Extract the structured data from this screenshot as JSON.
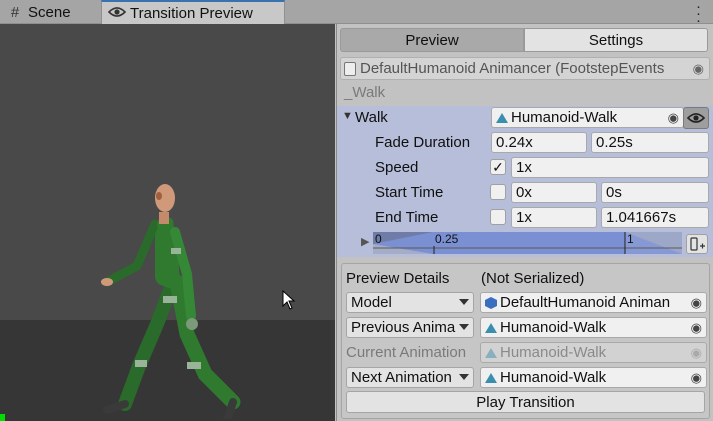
{
  "tabs": {
    "scene": "Scene",
    "transition_preview": "Transition Preview"
  },
  "icons": {
    "scene": "hash-icon",
    "transition_preview": "eye-icon",
    "menu": "kebab-menu-icon"
  },
  "inspector": {
    "mode_tabs": [
      "Preview",
      "Settings"
    ],
    "animancer_component": "DefaultHumanoid Animancer (FootstepEvents",
    "section_label": "_Walk",
    "walk": {
      "label": "Walk",
      "clip": "Humanoid-Walk",
      "fade_duration_label": "Fade Duration",
      "fade_duration_normalized": "0.24x",
      "fade_duration_seconds": "0.25s",
      "speed_label": "Speed",
      "speed_checked": true,
      "speed_value": "1x",
      "start_time_label": "Start Time",
      "start_time_checked": false,
      "start_time_normalized": "0x",
      "start_time_seconds": "0s",
      "end_time_label": "End Time",
      "end_time_checked": false,
      "end_time_normalized": "1x",
      "end_time_seconds": "1.041667s",
      "timeline_ticks": [
        "0",
        "0.25",
        "1"
      ]
    },
    "preview_details": {
      "title": "Preview Details",
      "serialized_note": "(Not Serialized)",
      "model_label": "Model",
      "model_value": "DefaultHumanoid Animan",
      "previous_label": "Previous Anima",
      "previous_value": "Humanoid-Walk",
      "current_label": "Current Animation",
      "current_value": "Humanoid-Walk",
      "next_label": "Next Animation",
      "next_value": "Humanoid-Walk",
      "play_button": "Play Transition"
    }
  },
  "colors": {
    "accent": "#3a72b0",
    "walk_highlight": "#b6bed9",
    "timeline": "#7b90d2",
    "character": "#2f7a2f"
  }
}
